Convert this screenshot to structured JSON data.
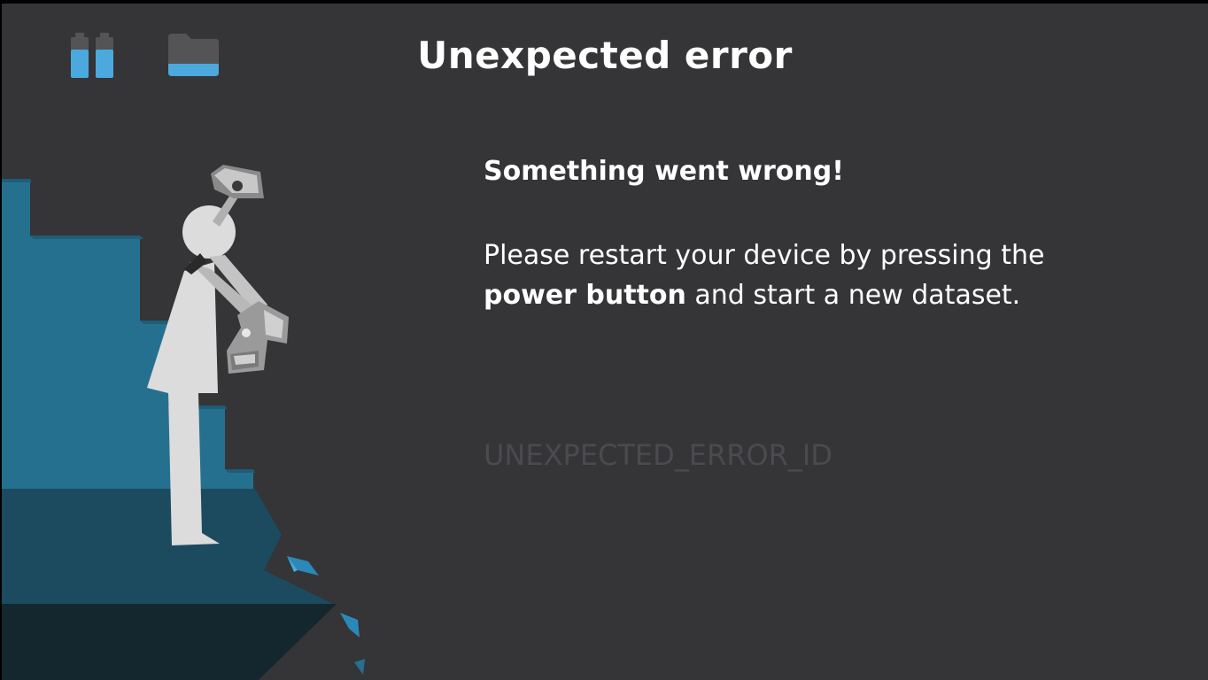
{
  "header": {
    "title": "Unexpected error",
    "battery_icon": "battery-icon",
    "storage_icon": "folder-icon"
  },
  "message": {
    "headline": "Something went wrong!",
    "line1": "Please restart your device by pressing the",
    "emphasis": "power button",
    "line2_rest": " and start a new dataset."
  },
  "error_id": "UNEXPECTED_ERROR_ID",
  "colors": {
    "background": "#353437",
    "accent_blue": "#4ba9dd",
    "cliff_blue": "#26708f",
    "cliff_mid": "#1c4b60",
    "cliff_dark": "#14272f",
    "figure_gray": "#dcdcdc",
    "icon_gray": "#545356",
    "error_id_text": "#4b4a4e"
  }
}
